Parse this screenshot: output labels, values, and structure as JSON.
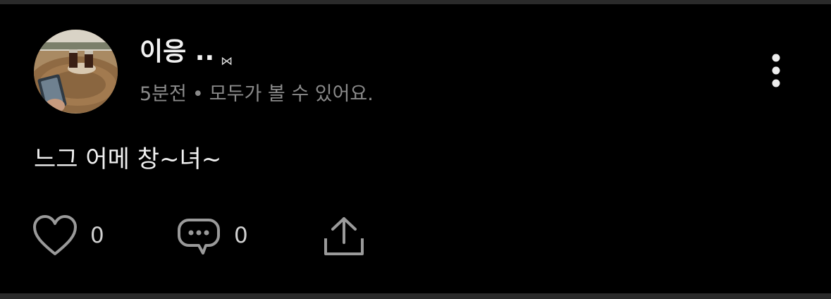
{
  "post": {
    "author": {
      "name": "이응 ..",
      "badge": "⋈"
    },
    "meta": {
      "time": "5분전",
      "separator": "•",
      "visibility": "모두가 볼 수 있어요."
    },
    "text": "느그 어메 창~녀~",
    "actions": {
      "like_count": "0",
      "comment_count": "0"
    }
  },
  "icons": {
    "avatar": "avatar-photo",
    "more": "vertical-ellipsis-icon",
    "like": "heart-icon",
    "comment": "speech-bubble-icon",
    "share": "share-upload-icon"
  },
  "colors": {
    "background": "#000000",
    "primary_text": "#f0f0f0",
    "secondary_text": "#8a8a8a",
    "icon": "#9a9a9a"
  }
}
